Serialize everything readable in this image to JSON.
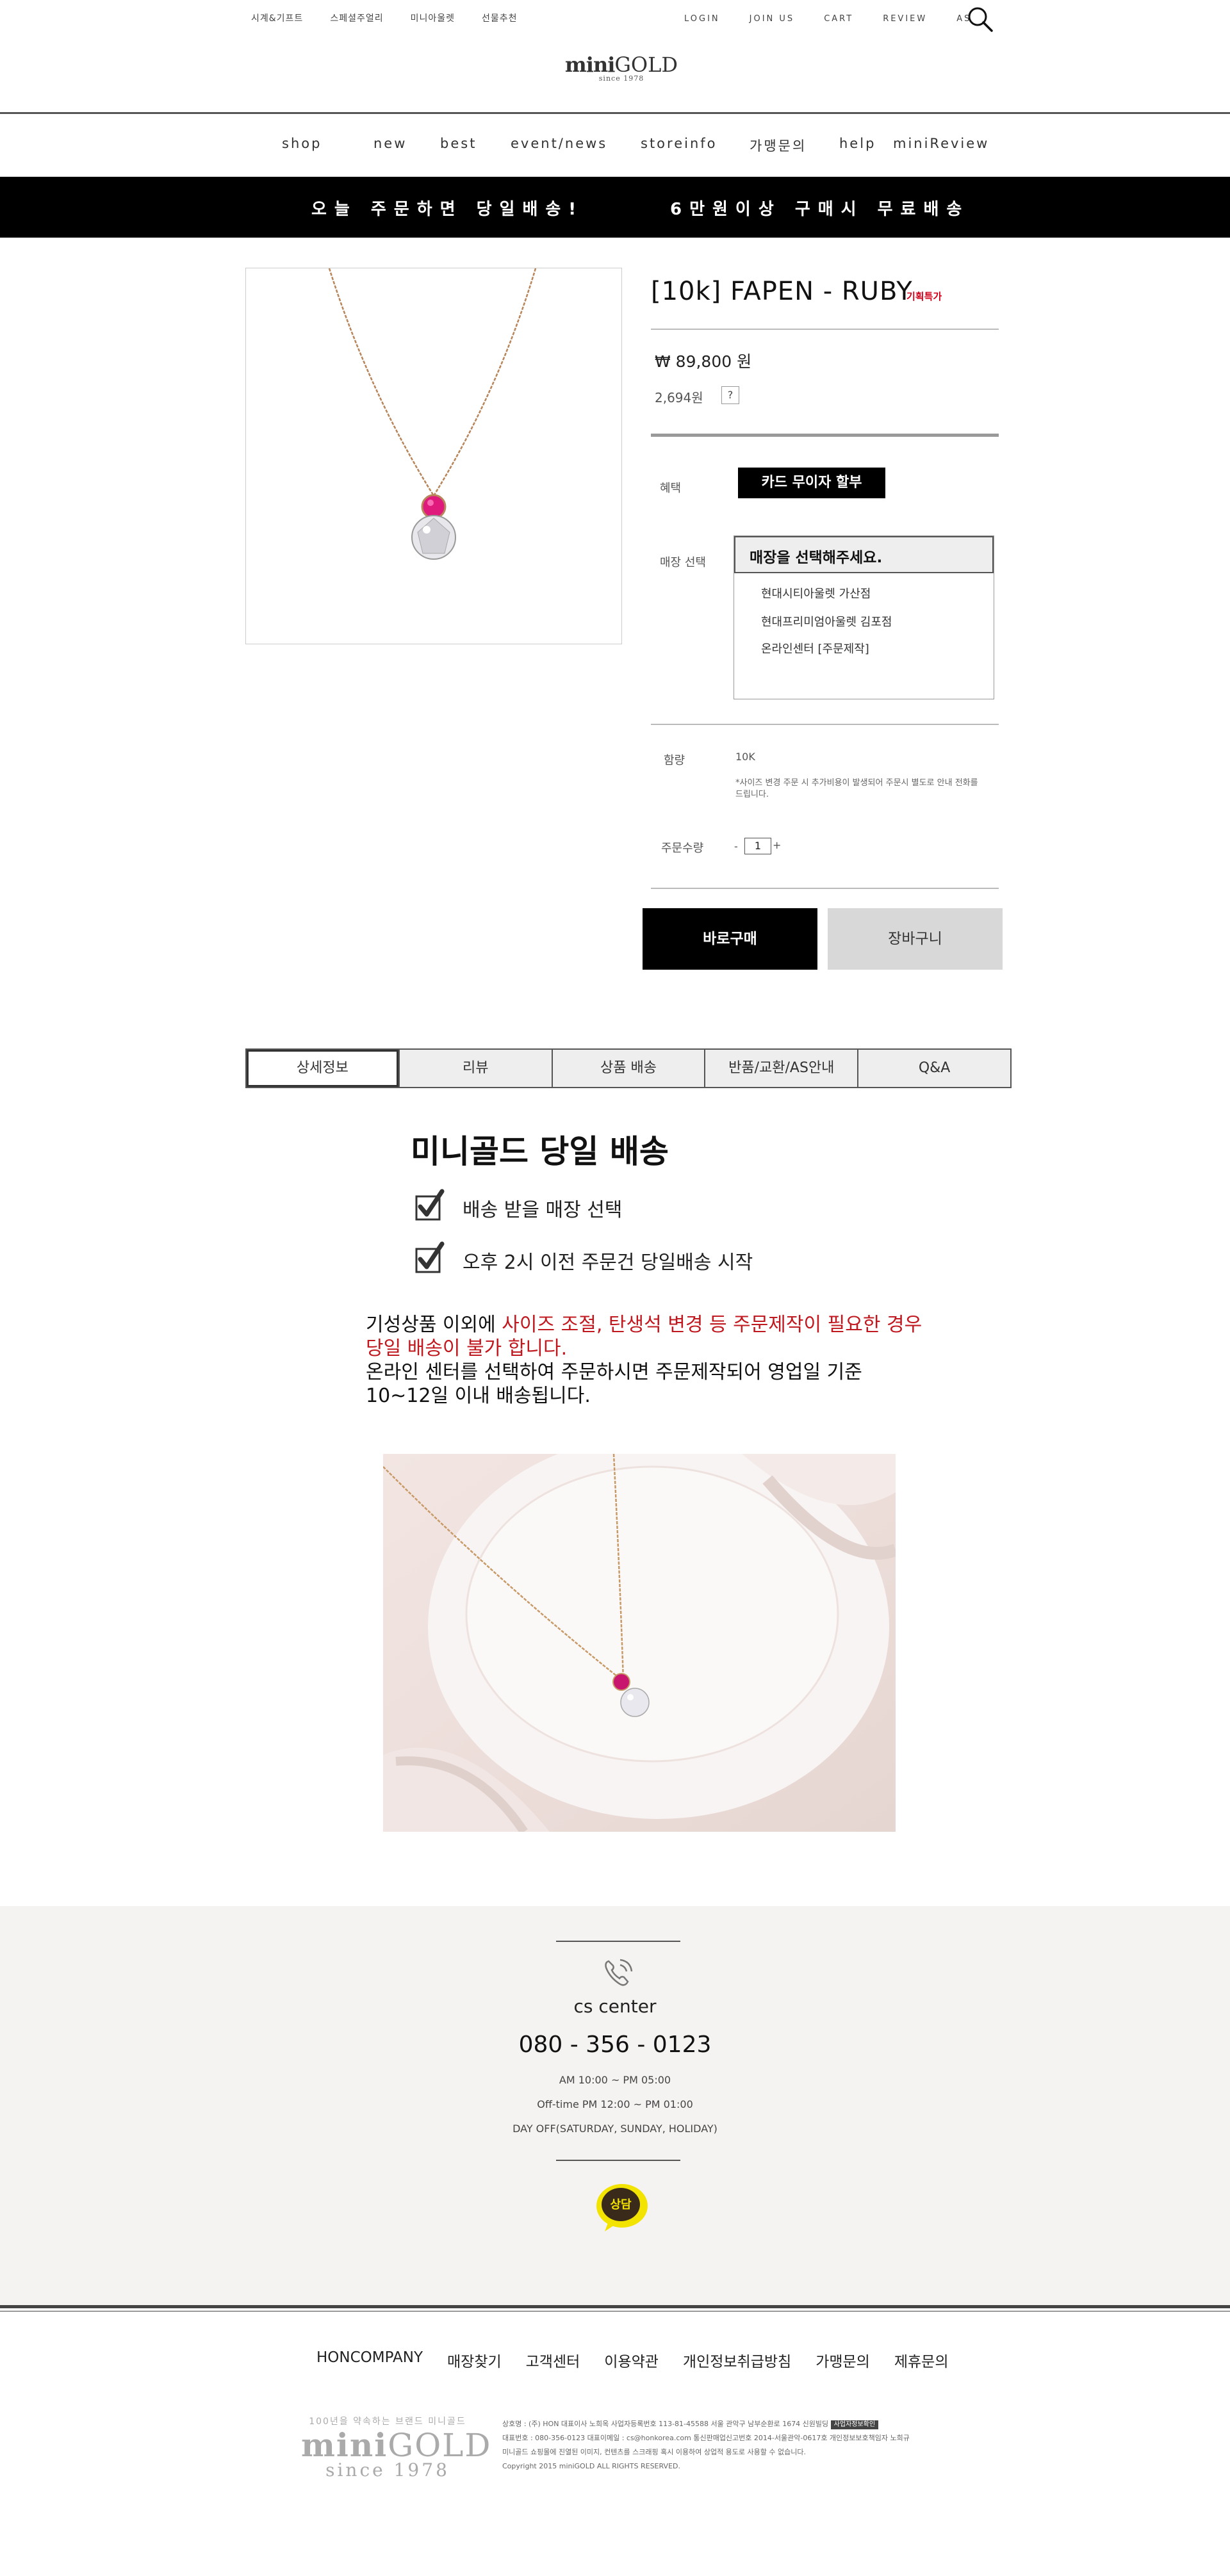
{
  "header": {
    "top_left": [
      "시계&기프트",
      "스페셜주얼리",
      "미니아울렛",
      "선물추천"
    ],
    "top_right": [
      "LOGIN",
      "JOIN US",
      "CART",
      "REVIEW",
      "AS"
    ],
    "logo": {
      "mini": "mini",
      "gold": "GOLD",
      "since": "since 1978"
    }
  },
  "nav": [
    "shop",
    "new",
    "best",
    "event/news",
    "storeinfo",
    "가맹문의",
    "help",
    "miniReview"
  ],
  "banner": {
    "left": "오늘 주문하면 당일배송!",
    "right": "6만원이상 구매시 무료배송"
  },
  "product": {
    "title": "[10k] FAPEN - RUBY",
    "badge": "기획특가",
    "price": "₩ 89,800 원",
    "points": "2,694원",
    "points_help": "?",
    "benefit_label": "혜택",
    "benefit_badge": "카드 무이자 할부",
    "store_label": "매장 선택",
    "store_placeholder": "매장을 선택해주세요.",
    "store_options": [
      "현대시티아울렛 가산점",
      "현대프리미엄아울렛 김포점",
      "온라인센터 [주문제작]"
    ],
    "karat_label": "함량",
    "karat_value": "10K",
    "karat_note": "*사이즈 변경 주문 시 추가비용이 발생되어 주문시 별도로 안내 전화를 드립니다.",
    "qty_label": "주문수량",
    "qty_minus": "-",
    "qty_value": "1",
    "qty_plus": "+",
    "buy_now": "바로구매",
    "cart": "장바구니"
  },
  "tabs": [
    "상세정보",
    "리뷰",
    "상품 배송",
    "반품/교환/AS안내",
    "Q&A"
  ],
  "detail": {
    "title": "미니골드 당일 배송",
    "checks": [
      "배송 받을 매장 선택",
      "오후 2시 이전 주문건 당일배송 시작"
    ],
    "para_black1": "기성상품 이외에 ",
    "para_red": "사이즈 조절, 탄생석 변경 등 주문제작이 필요한 경우 당일 배송이 불가 합니다.",
    "para_black2": "온라인 센터를 선택하여 주문하시면 주문제작되어 영업일 기준 10~12일 이내 배송됩니다."
  },
  "cs": {
    "title": "cs center",
    "phone": "080 - 356 - 0123",
    "hours": "AM 10:00 ~ PM 05:00",
    "offtime": "Off-time PM 12:00 ~ PM 01:00",
    "dayoff": "DAY OFF(SATURDAY, SUNDAY, HOLIDAY)",
    "talk_label": "상담"
  },
  "footer": {
    "nav": [
      "HONCOMPANY",
      "매장찾기",
      "고객센터",
      "이용약관",
      "개인정보취급방침",
      "가맹문의",
      "제휴문의"
    ],
    "logo_tag": "100년을 약속하는 브랜드 미니골드",
    "logo_mini": "mini",
    "logo_gold": "GOLD",
    "logo_since": "since 1978",
    "info_lines": [
      "상호명 : (주) HON   대표이사 노희옥   사업자등록번호 113-81-45588   서울 관악구 남부순환로 1674 신원빌딩",
      "대표번호 : 080-356-0123   대표이메일 : cs@honkorea.com   통신판매업신고번호 2014-서울관악-0617호   개인정보보호책임자 노희규",
      "미니골드 쇼핑몰에 진열된 이미지, 컨텐츠를 스크래핑 혹시 이용하여 상업적 용도로 사용할 수 없습니다.",
      "Copyright 2015 miniGOLD ALL RIGHTS RESERVED."
    ],
    "info_badge": "사업자정보확인"
  }
}
